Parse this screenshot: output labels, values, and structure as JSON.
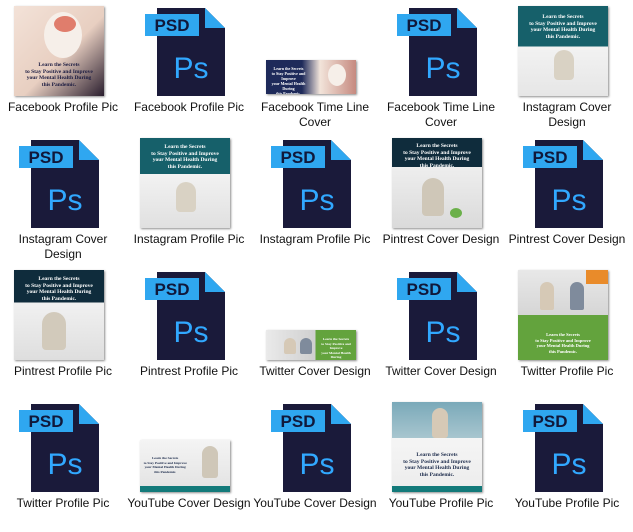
{
  "thumb_text": "Learn the Secrets\nto Stay Positive and Improve\nyour Mental Health During\nthis Pandemic.",
  "psd_badge": "PSD",
  "ps_glyph": "Ps",
  "colors": {
    "psd_body": "#1a1a3a",
    "psd_blue": "#2fa7f0",
    "teal": "#137a7a",
    "green": "#63a33d",
    "orange": "#e98b2a"
  },
  "items": [
    {
      "label": "Facebook Profile Pic",
      "kind": "image"
    },
    {
      "label": "Facebook Profile Pic",
      "kind": "psd"
    },
    {
      "label": "Facebook Time Line Cover",
      "kind": "image"
    },
    {
      "label": "Facebook Time Line Cover",
      "kind": "psd"
    },
    {
      "label": "Instagram Cover Design",
      "kind": "image"
    },
    {
      "label": "Instagram Cover Design",
      "kind": "psd"
    },
    {
      "label": "Instagram Profile Pic",
      "kind": "image"
    },
    {
      "label": "Instagram Profile Pic",
      "kind": "psd"
    },
    {
      "label": "Pintrest Cover Design",
      "kind": "image"
    },
    {
      "label": "Pintrest Cover Design",
      "kind": "psd"
    },
    {
      "label": "Pintrest Profile Pic",
      "kind": "image"
    },
    {
      "label": "Pintrest Profile Pic",
      "kind": "psd"
    },
    {
      "label": "Twitter Cover Design",
      "kind": "image"
    },
    {
      "label": "Twitter Cover Design",
      "kind": "psd"
    },
    {
      "label": "Twitter Profile Pic",
      "kind": "image"
    },
    {
      "label": "Twitter Profile Pic",
      "kind": "psd"
    },
    {
      "label": "YouTube Cover Design",
      "kind": "image"
    },
    {
      "label": "YouTube Cover Design",
      "kind": "psd"
    },
    {
      "label": "YouTube Profile Pic",
      "kind": "image"
    },
    {
      "label": "YouTube Profile Pic",
      "kind": "psd"
    }
  ]
}
